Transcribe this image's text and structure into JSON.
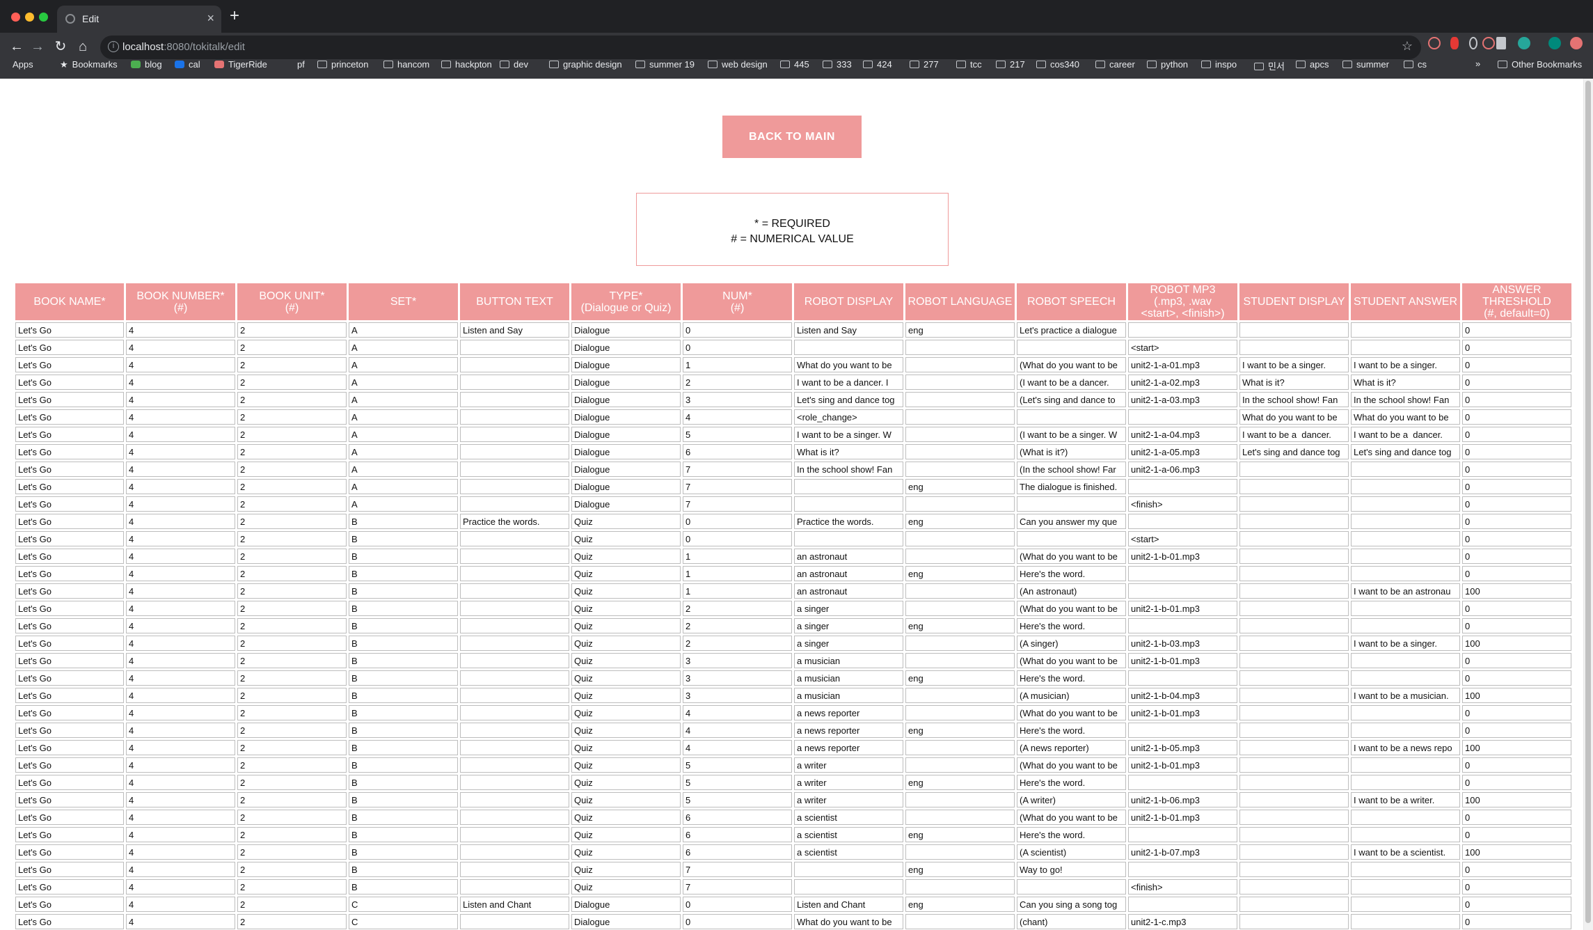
{
  "browser": {
    "tab_title": "Edit",
    "tab_close": "×",
    "new_tab": "+",
    "url_host": "localhost",
    "url_rest": ":8080/tokitalk/edit",
    "info_icon": "i",
    "bookmarks": [
      {
        "label": "Apps",
        "icon": "grid"
      },
      {
        "label": "Bookmarks",
        "icon": "star"
      },
      {
        "label": "blog",
        "icon": "color",
        "color": "#4caf50"
      },
      {
        "label": "cal",
        "icon": "color",
        "color": "#1a73e8"
      },
      {
        "label": "TigerRide",
        "icon": "color",
        "color": "#e57373"
      },
      {
        "label": "pf",
        "icon": "none"
      },
      {
        "label": "princeton",
        "icon": "folder"
      },
      {
        "label": "hancom",
        "icon": "folder"
      },
      {
        "label": "hackpton",
        "icon": "folder"
      },
      {
        "label": "dev",
        "icon": "folder"
      },
      {
        "label": "graphic design",
        "icon": "folder"
      },
      {
        "label": "summer 19",
        "icon": "folder"
      },
      {
        "label": "web design",
        "icon": "folder"
      },
      {
        "label": "445",
        "icon": "folder"
      },
      {
        "label": "333",
        "icon": "folder"
      },
      {
        "label": "424",
        "icon": "folder"
      },
      {
        "label": "277",
        "icon": "folder"
      },
      {
        "label": "tcc",
        "icon": "folder"
      },
      {
        "label": "217",
        "icon": "folder"
      },
      {
        "label": "cos340",
        "icon": "folder"
      },
      {
        "label": "career",
        "icon": "folder"
      },
      {
        "label": "python",
        "icon": "folder"
      },
      {
        "label": "inspo",
        "icon": "folder"
      },
      {
        "label": "민서",
        "icon": "folder"
      },
      {
        "label": "apcs",
        "icon": "folder"
      },
      {
        "label": "summer",
        "icon": "folder"
      },
      {
        "label": "cs",
        "icon": "folder"
      }
    ],
    "bookmarks_more": "»",
    "other_bookmarks": "Other Bookmarks"
  },
  "page": {
    "back_button": "BACK TO MAIN",
    "legend_required": "* = REQUIRED",
    "legend_numerical": "# = NUMERICAL VALUE"
  },
  "colors": {
    "accent": "#ef9a9a"
  },
  "table": {
    "headers": [
      [
        "BOOK NAME*"
      ],
      [
        "BOOK NUMBER*",
        "(#)"
      ],
      [
        "BOOK UNIT*",
        "(#)"
      ],
      [
        "SET*"
      ],
      [
        "BUTTON TEXT"
      ],
      [
        "TYPE*",
        "(Dialogue or Quiz)"
      ],
      [
        "NUM*",
        "(#)"
      ],
      [
        "ROBOT DISPLAY"
      ],
      [
        "ROBOT LANGUAGE"
      ],
      [
        "ROBOT SPEECH"
      ],
      [
        "ROBOT MP3",
        "(.mp3, .wav",
        "<start>, <finish>)"
      ],
      [
        "STUDENT DISPLAY"
      ],
      [
        "STUDENT ANSWER"
      ],
      [
        "ANSWER",
        "THRESHOLD",
        "(#, default=0)"
      ]
    ],
    "rows": [
      [
        "Let's Go",
        "4",
        "2",
        "A",
        "Listen and Say",
        "Dialogue",
        "0",
        "Listen and Say",
        "eng",
        "Let's practice a dialogue",
        "",
        "",
        "",
        "0"
      ],
      [
        "Let's Go",
        "4",
        "2",
        "A",
        "",
        "Dialogue",
        "0",
        "",
        "",
        "",
        "<start>",
        "",
        "",
        "0"
      ],
      [
        "Let's Go",
        "4",
        "2",
        "A",
        "",
        "Dialogue",
        "1",
        "What do you want to be",
        "",
        "(What do you want to be",
        "unit2-1-a-01.mp3",
        "I want to be a singer.",
        "I want to be a singer.",
        "0"
      ],
      [
        "Let's Go",
        "4",
        "2",
        "A",
        "",
        "Dialogue",
        "2",
        "I want to be a dancer. I",
        "",
        "(I want to be a dancer.",
        "unit2-1-a-02.mp3",
        "What is it?",
        "What is it?",
        "0"
      ],
      [
        "Let's Go",
        "4",
        "2",
        "A",
        "",
        "Dialogue",
        "3",
        "Let's sing and dance tog",
        "",
        "(Let's sing and dance to",
        "unit2-1-a-03.mp3",
        "In the school show! Fan",
        "In the school show! Fan",
        "0"
      ],
      [
        "Let's Go",
        "4",
        "2",
        "A",
        "",
        "Dialogue",
        "4",
        "<role_change>",
        "",
        "",
        "",
        "What do you want to be",
        "What do you want to be",
        "0"
      ],
      [
        "Let's Go",
        "4",
        "2",
        "A",
        "",
        "Dialogue",
        "5",
        "I want to be a singer. W",
        "",
        "(I want to be a singer. W",
        "unit2-1-a-04.mp3",
        "I want to be a  dancer.",
        "I want to be a  dancer.",
        "0"
      ],
      [
        "Let's Go",
        "4",
        "2",
        "A",
        "",
        "Dialogue",
        "6",
        "What is it?",
        "",
        "(What is it?)",
        "unit2-1-a-05.mp3",
        "Let's sing and dance tog",
        "Let's sing and dance tog",
        "0"
      ],
      [
        "Let's Go",
        "4",
        "2",
        "A",
        "",
        "Dialogue",
        "7",
        "In the school show! Fan",
        "",
        "(In the school show! Far",
        "unit2-1-a-06.mp3",
        "",
        "",
        "0"
      ],
      [
        "Let's Go",
        "4",
        "2",
        "A",
        "",
        "Dialogue",
        "7",
        "",
        "eng",
        "The dialogue is finished.",
        "",
        "",
        "",
        "0"
      ],
      [
        "Let's Go",
        "4",
        "2",
        "A",
        "",
        "Dialogue",
        "7",
        "",
        "",
        "",
        "<finish>",
        "",
        "",
        "0"
      ],
      [
        "Let's Go",
        "4",
        "2",
        "B",
        "Practice the words.",
        "Quiz",
        "0",
        "Practice the words.",
        "eng",
        "Can you answer my que",
        "",
        "",
        "",
        "0"
      ],
      [
        "Let's Go",
        "4",
        "2",
        "B",
        "",
        "Quiz",
        "0",
        "",
        "",
        "",
        "<start>",
        "",
        "",
        "0"
      ],
      [
        "Let's Go",
        "4",
        "2",
        "B",
        "",
        "Quiz",
        "1",
        "an astronaut",
        "",
        "(What do you want to be",
        "unit2-1-b-01.mp3",
        "",
        "",
        "0"
      ],
      [
        "Let's Go",
        "4",
        "2",
        "B",
        "",
        "Quiz",
        "1",
        "an astronaut",
        "eng",
        "Here's the word.",
        "",
        "",
        "",
        "0"
      ],
      [
        "Let's Go",
        "4",
        "2",
        "B",
        "",
        "Quiz",
        "1",
        "an astronaut",
        "",
        "(An astronaut)",
        "",
        "",
        "I want to be an astronau",
        "100"
      ],
      [
        "Let's Go",
        "4",
        "2",
        "B",
        "",
        "Quiz",
        "2",
        "a singer",
        "",
        "(What do you want to be",
        "unit2-1-b-01.mp3",
        "",
        "",
        "0"
      ],
      [
        "Let's Go",
        "4",
        "2",
        "B",
        "",
        "Quiz",
        "2",
        "a singer",
        "eng",
        "Here's the word.",
        "",
        "",
        "",
        "0"
      ],
      [
        "Let's Go",
        "4",
        "2",
        "B",
        "",
        "Quiz",
        "2",
        "a singer",
        "",
        "(A singer)",
        "unit2-1-b-03.mp3",
        "",
        "I want to be a singer.",
        "100"
      ],
      [
        "Let's Go",
        "4",
        "2",
        "B",
        "",
        "Quiz",
        "3",
        "a musician",
        "",
        "(What do you want to be",
        "unit2-1-b-01.mp3",
        "",
        "",
        "0"
      ],
      [
        "Let's Go",
        "4",
        "2",
        "B",
        "",
        "Quiz",
        "3",
        "a musician",
        "eng",
        "Here's the word.",
        "",
        "",
        "",
        "0"
      ],
      [
        "Let's Go",
        "4",
        "2",
        "B",
        "",
        "Quiz",
        "3",
        "a musician",
        "",
        "(A musician)",
        "unit2-1-b-04.mp3",
        "",
        "I want to be a musician.",
        "100"
      ],
      [
        "Let's Go",
        "4",
        "2",
        "B",
        "",
        "Quiz",
        "4",
        "a news reporter",
        "",
        "(What do you want to be",
        "unit2-1-b-01.mp3",
        "",
        "",
        "0"
      ],
      [
        "Let's Go",
        "4",
        "2",
        "B",
        "",
        "Quiz",
        "4",
        "a news reporter",
        "eng",
        "Here's the word.",
        "",
        "",
        "",
        "0"
      ],
      [
        "Let's Go",
        "4",
        "2",
        "B",
        "",
        "Quiz",
        "4",
        "a news reporter",
        "",
        "(A news reporter)",
        "unit2-1-b-05.mp3",
        "",
        "I want to be a news repo",
        "100"
      ],
      [
        "Let's Go",
        "4",
        "2",
        "B",
        "",
        "Quiz",
        "5",
        "a writer",
        "",
        "(What do you want to be",
        "unit2-1-b-01.mp3",
        "",
        "",
        "0"
      ],
      [
        "Let's Go",
        "4",
        "2",
        "B",
        "",
        "Quiz",
        "5",
        "a writer",
        "eng",
        "Here's the word.",
        "",
        "",
        "",
        "0"
      ],
      [
        "Let's Go",
        "4",
        "2",
        "B",
        "",
        "Quiz",
        "5",
        "a writer",
        "",
        "(A writer)",
        "unit2-1-b-06.mp3",
        "",
        "I want to be a writer.",
        "100"
      ],
      [
        "Let's Go",
        "4",
        "2",
        "B",
        "",
        "Quiz",
        "6",
        "a scientist",
        "",
        "(What do you want to be",
        "unit2-1-b-01.mp3",
        "",
        "",
        "0"
      ],
      [
        "Let's Go",
        "4",
        "2",
        "B",
        "",
        "Quiz",
        "6",
        "a scientist",
        "eng",
        "Here's the word.",
        "",
        "",
        "",
        "0"
      ],
      [
        "Let's Go",
        "4",
        "2",
        "B",
        "",
        "Quiz",
        "6",
        "a scientist",
        "",
        "(A scientist)",
        "unit2-1-b-07.mp3",
        "",
        "I want to be a scientist.",
        "100"
      ],
      [
        "Let's Go",
        "4",
        "2",
        "B",
        "",
        "Quiz",
        "7",
        "",
        "eng",
        "Way to go!",
        "",
        "",
        "",
        "0"
      ],
      [
        "Let's Go",
        "4",
        "2",
        "B",
        "",
        "Quiz",
        "7",
        "",
        "",
        "",
        "<finish>",
        "",
        "",
        "0"
      ],
      [
        "Let's Go",
        "4",
        "2",
        "C",
        "Listen and Chant",
        "Dialogue",
        "0",
        "Listen and Chant",
        "eng",
        "Can you sing a song tog",
        "",
        "",
        "",
        "0"
      ],
      [
        "Let's Go",
        "4",
        "2",
        "C",
        "",
        "Dialogue",
        "0",
        "What do you want to be",
        "",
        "(chant)",
        "unit2-1-c.mp3",
        "",
        "",
        "0"
      ]
    ]
  }
}
